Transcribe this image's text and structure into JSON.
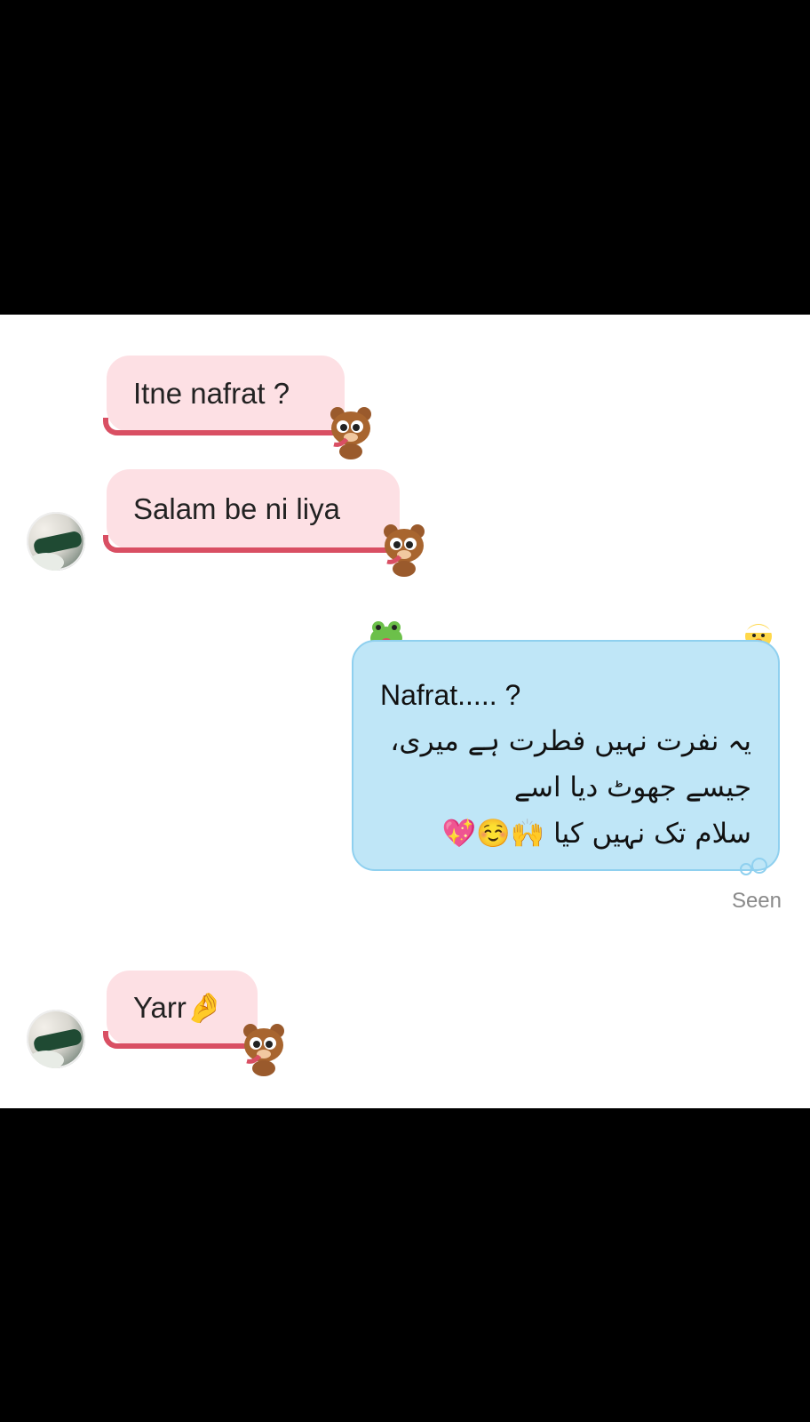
{
  "messages": [
    {
      "side": "incoming",
      "text": "Itne nafrat ?"
    },
    {
      "side": "incoming",
      "text": "Salam be ni liya"
    },
    {
      "side": "outgoing",
      "line1": "Nafrat.....  ?",
      "line2": "یہ نفرت نہیں فطرت ہے میری،",
      "line3": "جیسے جھوٹ دیا اسے",
      "line4": "سلام تک نہیں کیا",
      "emojis": "🙌☺️💖"
    },
    {
      "side": "incoming",
      "text": "Yarr",
      "emoji": "🤌"
    }
  ],
  "status": {
    "seen": "Seen"
  },
  "colors": {
    "incoming_bubble": "#fde0e4",
    "incoming_tail": "#d94f63",
    "outgoing_bubble": "#bfe6f7",
    "outgoing_border": "#8fd0ef",
    "seen_text": "#8a8a8a"
  },
  "icons": {
    "bear": "bear-sticker-icon",
    "frog": "frog-sticker-icon",
    "duck": "duck-sticker-icon",
    "bubbles": "bubbles-icon"
  }
}
